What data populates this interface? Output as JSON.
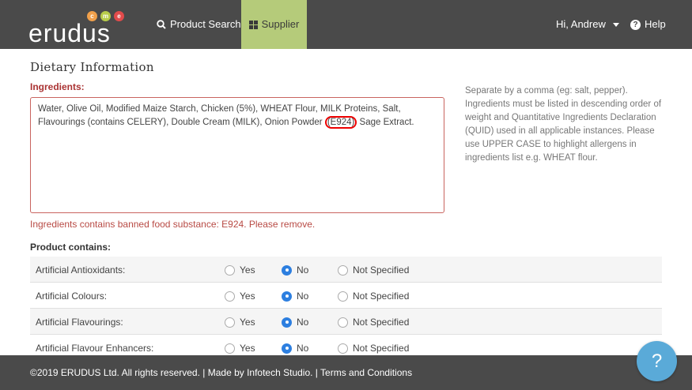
{
  "brand": {
    "logo_text": "erudus",
    "dots": [
      "c",
      "m",
      "e"
    ]
  },
  "nav": {
    "product_search": "Product Search",
    "supplier": "Supplier",
    "user_greeting": "Hi, Andrew",
    "help": "Help"
  },
  "section_title": "Dietary Information",
  "ingredients": {
    "label": "Ingredients:",
    "value_before": "Water, Olive Oil, Modified Maize Starch, Chicken (5%), WHEAT Flour, MILK Proteins, Salt, Flavourings (contains CELERY), Double Cream (MILK), Onion Powder ",
    "value_highlight": "(E924)",
    "value_after": " Sage Extract.",
    "help_text": "Separate by a comma (eg: salt, pepper). Ingredients must be listed in descending order of weight and Quantitative Ingredients Declaration (QUID) used in all applicable instances. Please use UPPER CASE to highlight allergens in ingredients list e.g. WHEAT flour.",
    "error": "Ingredients contains banned food substance: E924. Please remove."
  },
  "product_contains": {
    "label": "Product contains:",
    "option_labels": {
      "yes": "Yes",
      "no": "No",
      "not_specified": "Not Specified"
    },
    "rows": [
      {
        "label": "Artificial Antioxidants:",
        "selected": "no"
      },
      {
        "label": "Artificial Colours:",
        "selected": "no"
      },
      {
        "label": "Artificial Flavourings:",
        "selected": "no"
      },
      {
        "label": "Artificial Flavour Enhancers:",
        "selected": "no"
      }
    ]
  },
  "footer": {
    "text": "©2019 ERUDUS Ltd. All rights reserved. | Made by Infotech Studio. | Terms and Conditions"
  },
  "help_fab": "?",
  "colors": {
    "topbar": "#4a4a4a",
    "accent_green": "#b5cb7a",
    "error": "#b84a44",
    "radio_on": "#2d7fe0",
    "fab": "#5aaad8"
  }
}
